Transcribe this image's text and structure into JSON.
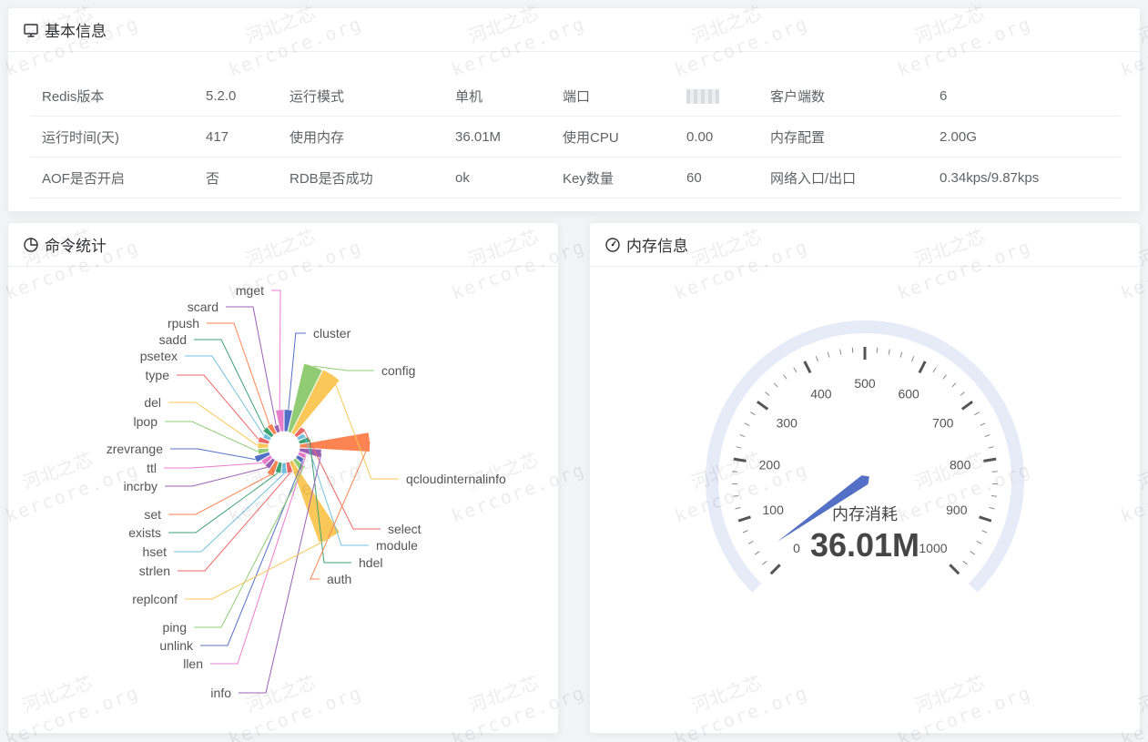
{
  "basic": {
    "title": "基本信息",
    "rows": [
      [
        {
          "label": "Redis版本",
          "value": "5.2.0"
        },
        {
          "label": "运行模式",
          "value": "单机"
        },
        {
          "label": "端口",
          "value": "",
          "masked": true
        },
        {
          "label": "客户端数",
          "value": "6"
        }
      ],
      [
        {
          "label": "运行时间(天)",
          "value": "417"
        },
        {
          "label": "使用内存",
          "value": "36.01M"
        },
        {
          "label": "使用CPU",
          "value": "0.00"
        },
        {
          "label": "内存配置",
          "value": "2.00G"
        }
      ],
      [
        {
          "label": "AOF是否开启",
          "value": "否"
        },
        {
          "label": "RDB是否成功",
          "value": "ok"
        },
        {
          "label": "Key数量",
          "value": "60"
        },
        {
          "label": "网络入口/出口",
          "value": "0.34kps/9.87kps"
        }
      ]
    ]
  },
  "commands": {
    "title": "命令统计",
    "icon": "pie-chart-icon"
  },
  "memory": {
    "title": "内存信息",
    "icon": "speedometer-icon"
  },
  "chart_data": [
    {
      "type": "pie",
      "variant": "rose",
      "categories": [
        "cluster",
        "config",
        "qcloudinternalinfo",
        "select",
        "module",
        "hdel",
        "auth",
        "info",
        "llen",
        "unlink",
        "ping",
        "replconf",
        "strlen",
        "hset",
        "exists",
        "set",
        "incrby",
        "ttl",
        "zrevrange",
        "lpop",
        "del",
        "type",
        "psetex",
        "sadd",
        "rpush",
        "scard",
        "mget"
      ],
      "values": [
        8,
        80,
        82,
        2,
        1,
        2,
        80,
        8,
        1,
        1,
        3,
        120,
        2,
        2,
        2,
        4,
        2,
        2,
        4,
        2,
        2,
        2,
        1,
        2,
        2,
        1,
        8
      ],
      "colors": [
        "#5470c6",
        "#91cc75",
        "#fac858",
        "#ee6666",
        "#73c0de",
        "#3ba272",
        "#fc8452",
        "#9a60b4",
        "#ea7ccc"
      ]
    },
    {
      "type": "gauge",
      "title": "内存消耗",
      "value": 36.01,
      "value_label": "36.01M",
      "min": 0,
      "max": 1000,
      "tick_labels": [
        "0",
        "100",
        "200",
        "300",
        "400",
        "500",
        "600",
        "700",
        "800",
        "900",
        "1000"
      ]
    }
  ],
  "watermark": {
    "line1": "河北之芯",
    "line2": "kercore.org"
  }
}
